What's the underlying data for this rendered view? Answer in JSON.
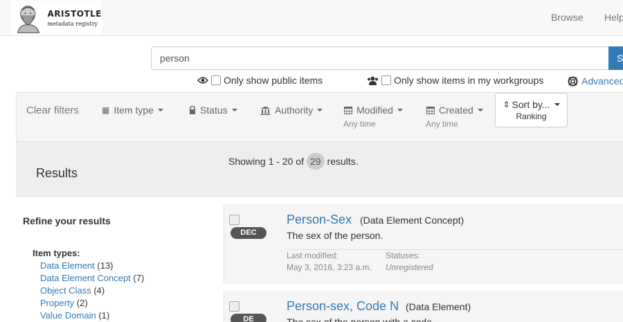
{
  "brand": {
    "name": "ARISTOTLE",
    "subtitle": "metadata registry"
  },
  "nav": {
    "browse": "Browse",
    "help": "Help"
  },
  "search": {
    "value": "person",
    "button": "Search"
  },
  "options": {
    "public_only": "Only show public items",
    "workgroups_only": "Only show items in my workgroups",
    "advanced": "Advanced"
  },
  "filters": {
    "clear": "Clear filters",
    "item_type": "Item type",
    "status": "Status",
    "authority": "Authority",
    "modified": "Modified",
    "modified_sub": "Any time",
    "created": "Created",
    "created_sub": "Any time",
    "sort_label": "Sort by...",
    "sort_value": "Ranking"
  },
  "results": {
    "title": "Results",
    "showing_prefix": "Showing 1 - 20 of",
    "total": "29",
    "showing_suffix": "results."
  },
  "refine": {
    "title": "Refine your results",
    "item_types_label": "Item types:",
    "item_types": [
      {
        "label": "Data Element",
        "count": "(13)"
      },
      {
        "label": "Data Element Concept",
        "count": "(7)"
      },
      {
        "label": "Object Class",
        "count": "(4)"
      },
      {
        "label": "Property",
        "count": "(2)"
      },
      {
        "label": "Value Domain",
        "count": "(1)"
      }
    ]
  },
  "items": [
    {
      "badge": "DEC",
      "title": "Person-Sex",
      "type": "(Data Element Concept)",
      "description": "The sex of the person.",
      "modified_label": "Last modified:",
      "modified_value": "May 3, 2016, 3:23 a.m.",
      "status_label": "Statuses:",
      "status_value": "Unregistered"
    },
    {
      "badge": "DE",
      "title": "Person-sex, Code N",
      "type": "(Data Element)",
      "description": "The sex of the person with a code."
    }
  ]
}
